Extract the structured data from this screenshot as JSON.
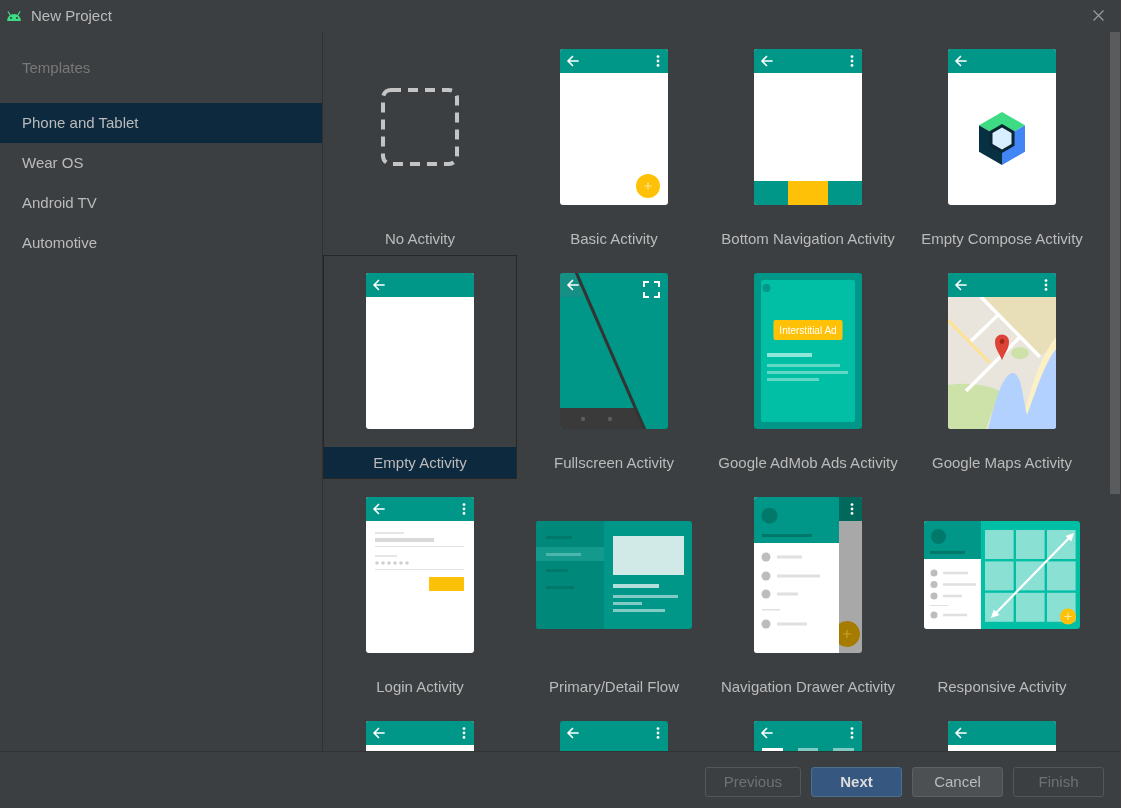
{
  "window": {
    "title": "New Project"
  },
  "sidebar": {
    "heading": "Templates",
    "items": [
      {
        "label": "Phone and Tablet",
        "selected": true
      },
      {
        "label": "Wear OS",
        "selected": false
      },
      {
        "label": "Android TV",
        "selected": false
      },
      {
        "label": "Automotive",
        "selected": false
      }
    ]
  },
  "templates": [
    {
      "label": "No Activity",
      "kind": "blank",
      "selected": false
    },
    {
      "label": "Basic Activity",
      "kind": "basic",
      "selected": false
    },
    {
      "label": "Bottom Navigation Activity",
      "kind": "bottomnav",
      "selected": false
    },
    {
      "label": "Empty Compose Activity",
      "kind": "compose",
      "selected": false
    },
    {
      "label": "Empty Activity",
      "kind": "empty",
      "selected": true
    },
    {
      "label": "Fullscreen Activity",
      "kind": "fullscreen",
      "selected": false
    },
    {
      "label": "Google AdMob Ads Activity",
      "kind": "admob",
      "selected": false,
      "preview_text": "Interstitial Ad"
    },
    {
      "label": "Google Maps Activity",
      "kind": "maps",
      "selected": false
    },
    {
      "label": "Login Activity",
      "kind": "login",
      "selected": false
    },
    {
      "label": "Primary/Detail Flow",
      "kind": "masterdetail",
      "selected": false
    },
    {
      "label": "Navigation Drawer Activity",
      "kind": "drawer",
      "selected": false
    },
    {
      "label": "Responsive Activity",
      "kind": "responsive",
      "selected": false
    },
    {
      "kind": "menu",
      "selected": false
    },
    {
      "kind": "scrolling",
      "selected": false
    },
    {
      "kind": "tabbed",
      "selected": false
    },
    {
      "kind": "empty",
      "selected": false
    }
  ],
  "buttons": [
    {
      "label": "Previous",
      "disabled": true,
      "default": false
    },
    {
      "label": "Next",
      "disabled": false,
      "default": true
    },
    {
      "label": "Cancel",
      "disabled": false,
      "default": false
    },
    {
      "label": "Finish",
      "disabled": true,
      "default": false
    }
  ]
}
